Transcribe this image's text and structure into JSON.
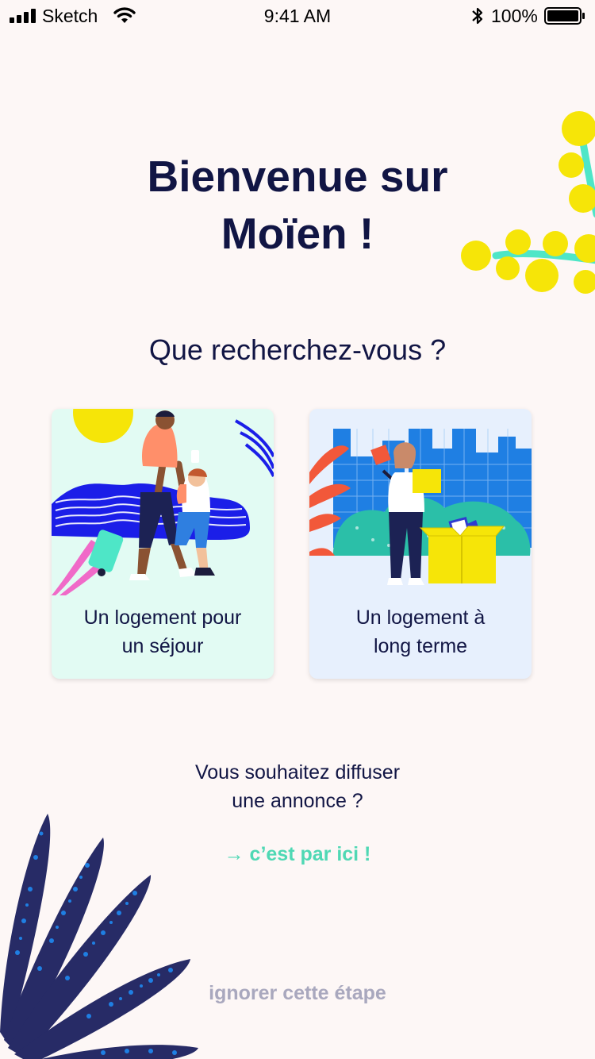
{
  "status_bar": {
    "carrier": "Sketch",
    "time": "9:41 AM",
    "battery_percent": "100%",
    "icons": [
      "signal-icon",
      "wifi-icon",
      "bluetooth-icon",
      "battery-icon"
    ]
  },
  "welcome": {
    "title_line1": "Bienvenue sur",
    "title_line2": "Moïen !"
  },
  "question": "Que recherchez-vous ?",
  "options": [
    {
      "label_line1": "Un logement pour",
      "label_line2": "un séjour",
      "illustration": "travelers-illustration"
    },
    {
      "label_line1": "Un logement à",
      "label_line2": "long terme",
      "illustration": "moving-illustration"
    }
  ],
  "post_ad": {
    "question_line1": "Vous souhaitez diffuser",
    "question_line2": "une annonce ?",
    "link": "→ c’est par ici !"
  },
  "skip": "ignorer cette étape",
  "colors": {
    "background": "#fdf7f6",
    "text_dark": "#111544",
    "accent_green": "#4fd8b4",
    "muted": "#a9a8be",
    "card_stay_bg": "#e2fbf3",
    "card_long_bg": "#e7f0fd",
    "mimosa_yellow": "#f6e508",
    "leaf_navy": "#272b66"
  }
}
